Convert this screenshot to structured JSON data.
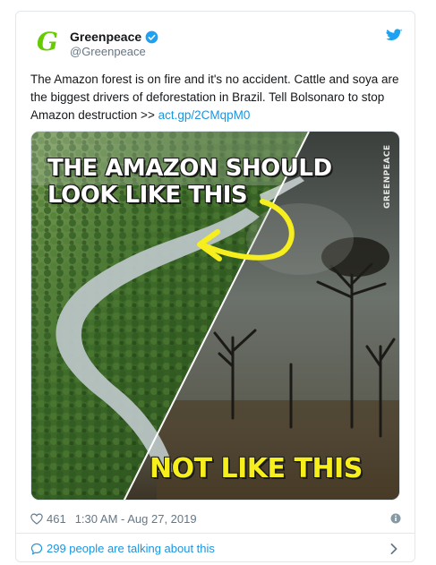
{
  "account": {
    "name": "Greenpeace",
    "handle": "@Greenpeace",
    "avatar_icon": "greenpeace-g-logo",
    "verified_icon": "verified-badge-icon",
    "platform_icon": "twitter-bird-icon",
    "brand_color": "#66cc00"
  },
  "tweet": {
    "text": "The Amazon forest is on fire and it's no accident. Cattle and soya are the biggest drivers of deforestation in Brazil. Tell Bolsonaro to stop Amazon destruction >> ",
    "link": "act.gp/2CMqpM0",
    "link_color": "#1b95e0"
  },
  "media": {
    "line1": "THE AMAZON SHOULD",
    "line2": "LOOK LIKE THIS",
    "line3": "NOT LIKE THIS",
    "watermark": "GREENPEACE",
    "arrow_color": "#f7ee1e"
  },
  "meta": {
    "likes": "461",
    "like_icon": "heart-icon",
    "timestamp": "1:30 AM - Aug 27, 2019",
    "info_icon": "info-icon"
  },
  "footer": {
    "talking": "299 people are talking about this",
    "icon": "speech-bubble-icon",
    "chevron": "chevron-right-icon"
  }
}
